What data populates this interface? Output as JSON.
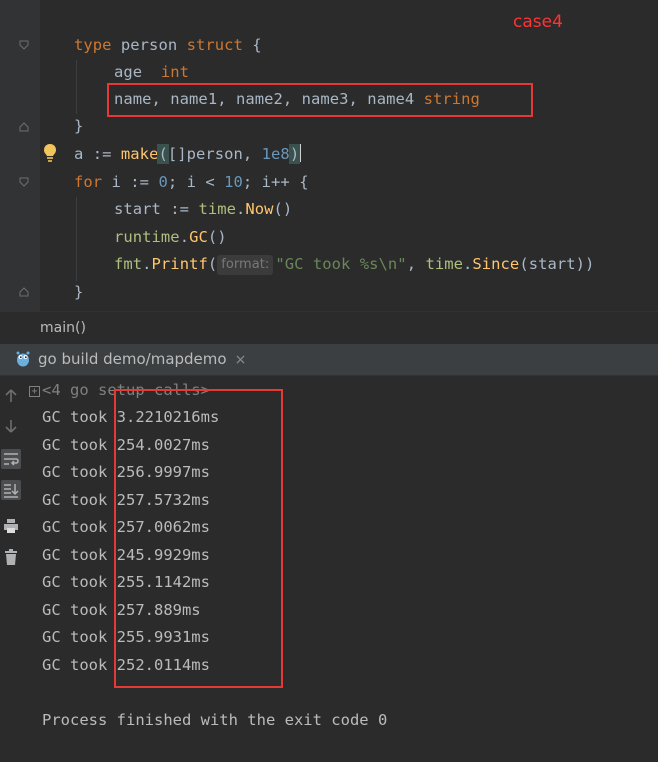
{
  "annotation": {
    "case_label": "case4"
  },
  "editor": {
    "lines": {
      "type_decl": {
        "kw_type": "type",
        "name": " person ",
        "kw_struct": "struct",
        "brace": " {"
      },
      "age_field": {
        "name": "age  ",
        "type": "int"
      },
      "names_field": {
        "names": "name, name1, name2, name3, name4 ",
        "type": "string"
      },
      "close_struct": "}",
      "make_line": {
        "lhs": "a := ",
        "fn": "make",
        "open": "(",
        "body": "[]person, ",
        "num": "1e8",
        "close": ")"
      },
      "for_line": {
        "kw": "for",
        "init": " i := ",
        "zero": "0",
        "mid": "; i < ",
        "ten": "10",
        "post": "; i++ {"
      },
      "start_line": {
        "lhs": "start := ",
        "pkg": "time",
        "dot": ".",
        "fn": "Now",
        "rest": "()"
      },
      "gc_line": {
        "pkg": "runtime",
        "dot": ".",
        "fn": "GC",
        "rest": "()"
      },
      "printf_line": {
        "pkg": "fmt",
        "dot": ".",
        "fn": "Printf",
        "open": "(",
        "hint": "format:",
        "str": "\"GC took %s\\n\"",
        "comma": ", ",
        "pkg2": "time",
        "dot2": ".",
        "fn2": "Since",
        "rest": "(start))"
      },
      "close_for": "}"
    }
  },
  "breadcrumb": {
    "label": "main()"
  },
  "run_panel": {
    "tab_label": "go build demo/mapdemo",
    "close_glyph": "×"
  },
  "console": {
    "collapsed_calls": "<4 go setup calls>",
    "gc_prefix": "GC took ",
    "gc_times": [
      "3.2210216ms",
      "254.0027ms",
      "256.9997ms",
      "257.5732ms",
      "257.0062ms",
      "245.9929ms",
      "255.1142ms",
      "257.889ms",
      "255.9931ms",
      "252.0114ms"
    ],
    "exit_message": "Process finished with the exit code 0"
  },
  "colors": {
    "keyword": "#cc7832",
    "function": "#ffc66d",
    "number": "#6897bb",
    "string": "#6a8759",
    "annotation": "#e53935"
  },
  "icons": [
    "fold-marker-icon",
    "lightbulb-icon",
    "gopher-icon",
    "up-arrow-icon",
    "down-arrow-icon",
    "soft-wrap-icon",
    "scroll-to-end-icon",
    "print-icon",
    "trash-icon"
  ]
}
